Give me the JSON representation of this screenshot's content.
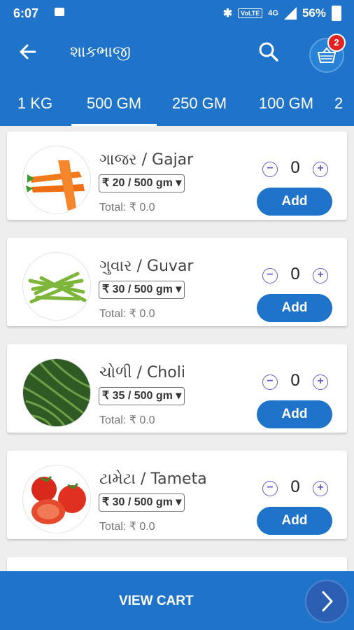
{
  "status_bar": {
    "time": "6:07",
    "battery": "56%",
    "network": "4G",
    "volte": "VoLTE"
  },
  "app_bar": {
    "title": "શાકભાજી",
    "cart_count": "2"
  },
  "tabs": [
    "1 KG",
    "500 GM",
    "250 GM",
    "100 GM",
    "2"
  ],
  "active_tab": "500 GM",
  "products": [
    {
      "name": "ગાજર / Gajar",
      "price": "₹ 20 / 500 gm ▾",
      "total": "Total: ₹ 0.0",
      "qty": "0",
      "add": "Add",
      "image": "carrots"
    },
    {
      "name": "ગુવાર / Guvar",
      "price": "₹ 30 / 500 gm ▾",
      "total": "Total: ₹ 0.0",
      "qty": "0",
      "add": "Add",
      "image": "cluster-beans"
    },
    {
      "name": "ચોળી / Choli",
      "price": "₹ 35 / 500 gm ▾",
      "total": "Total: ₹ 0.0",
      "qty": "0",
      "add": "Add",
      "image": "long-beans"
    },
    {
      "name": "ટામેટા / Tameta",
      "price": "₹ 30 / 500 gm ▾",
      "total": "Total: ₹ 0.0",
      "qty": "0",
      "add": "Add",
      "image": "tomatoes"
    }
  ],
  "bottom_bar": {
    "view_cart_label": "VIEW CART"
  },
  "colors": {
    "primary": "#1f73c9",
    "badge": "#e02424",
    "stepper": "#6a5acd"
  }
}
